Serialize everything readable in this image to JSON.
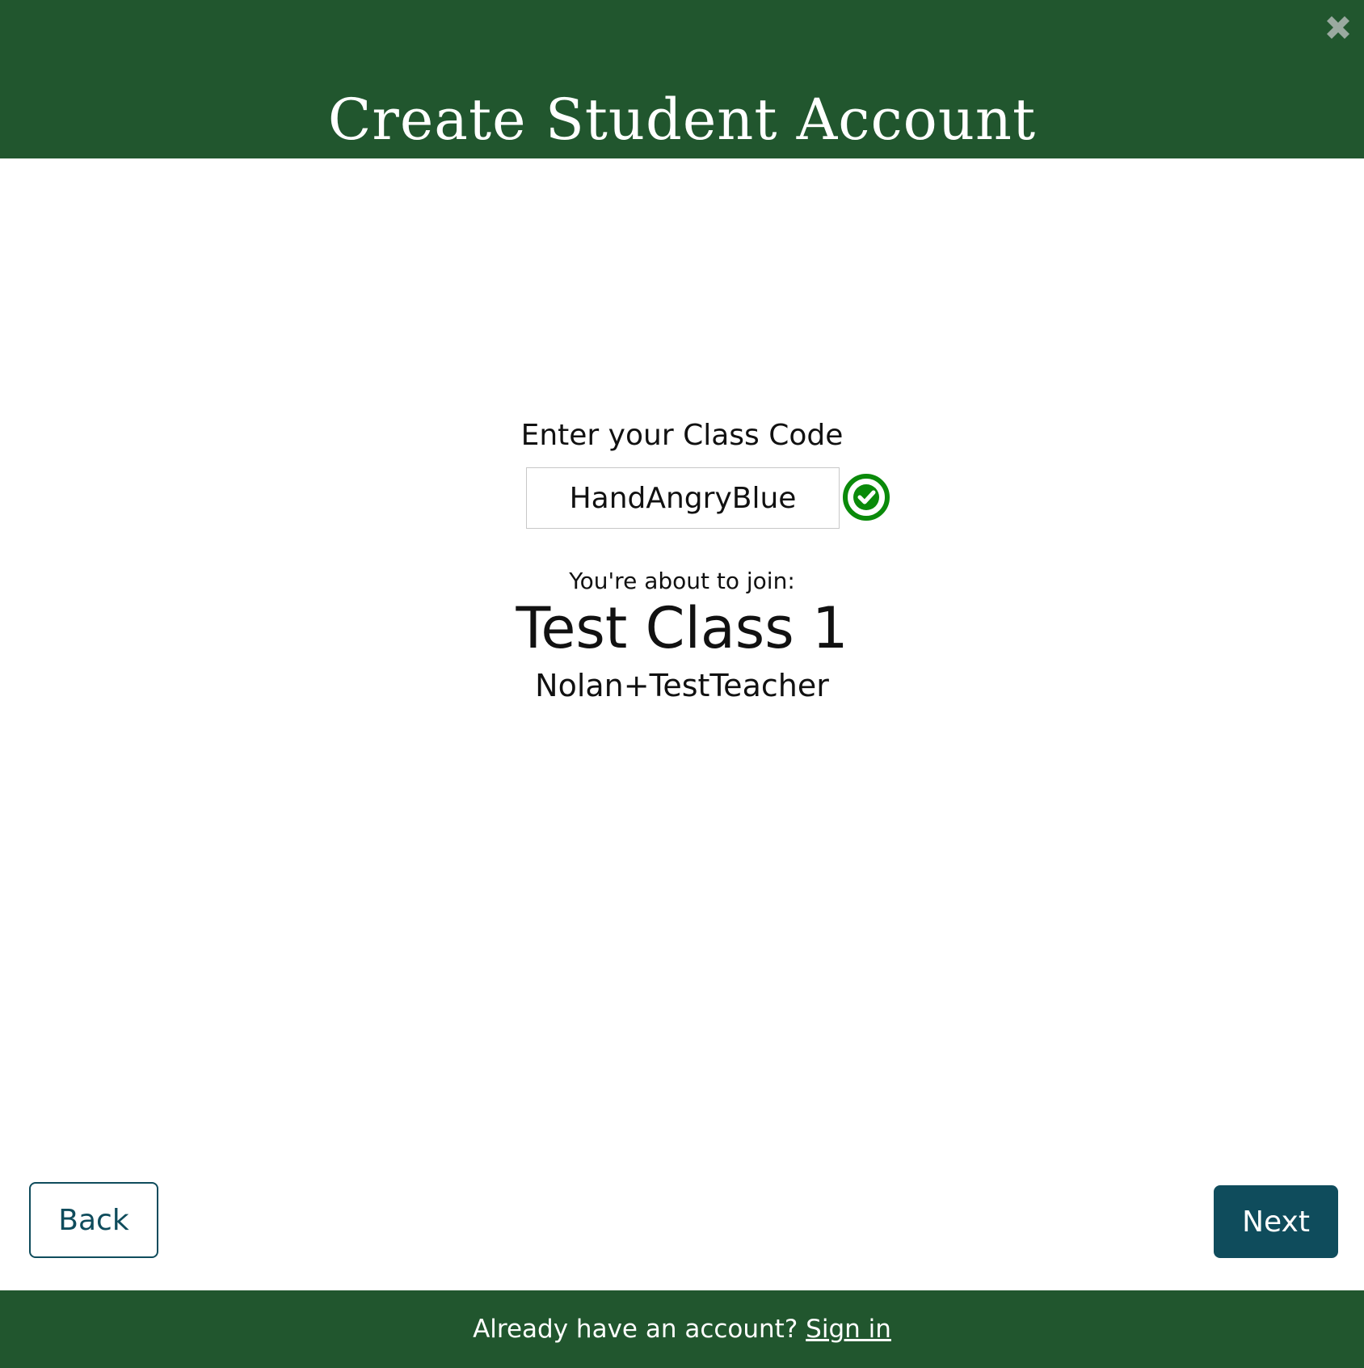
{
  "header": {
    "title": "Create Student Account",
    "close_icon": "close-x-icon"
  },
  "class_code": {
    "label": "Enter your Class Code",
    "value": "HandAngryBlue",
    "status_icon": "check-circle-icon"
  },
  "join_info": {
    "prompt": "You're about to join:",
    "class_name": "Test Class 1",
    "teacher_name": "Nolan+TestTeacher"
  },
  "buttons": {
    "back_label": "Back",
    "next_label": "Next"
  },
  "footer": {
    "prompt": "Already have an account?",
    "sign_in_label": "Sign in"
  },
  "colors": {
    "header_bg": "#21562e",
    "button_primary": "#0f4c5c",
    "check_green": "#0a8a0a",
    "close_gray": "#9aa9a0"
  }
}
